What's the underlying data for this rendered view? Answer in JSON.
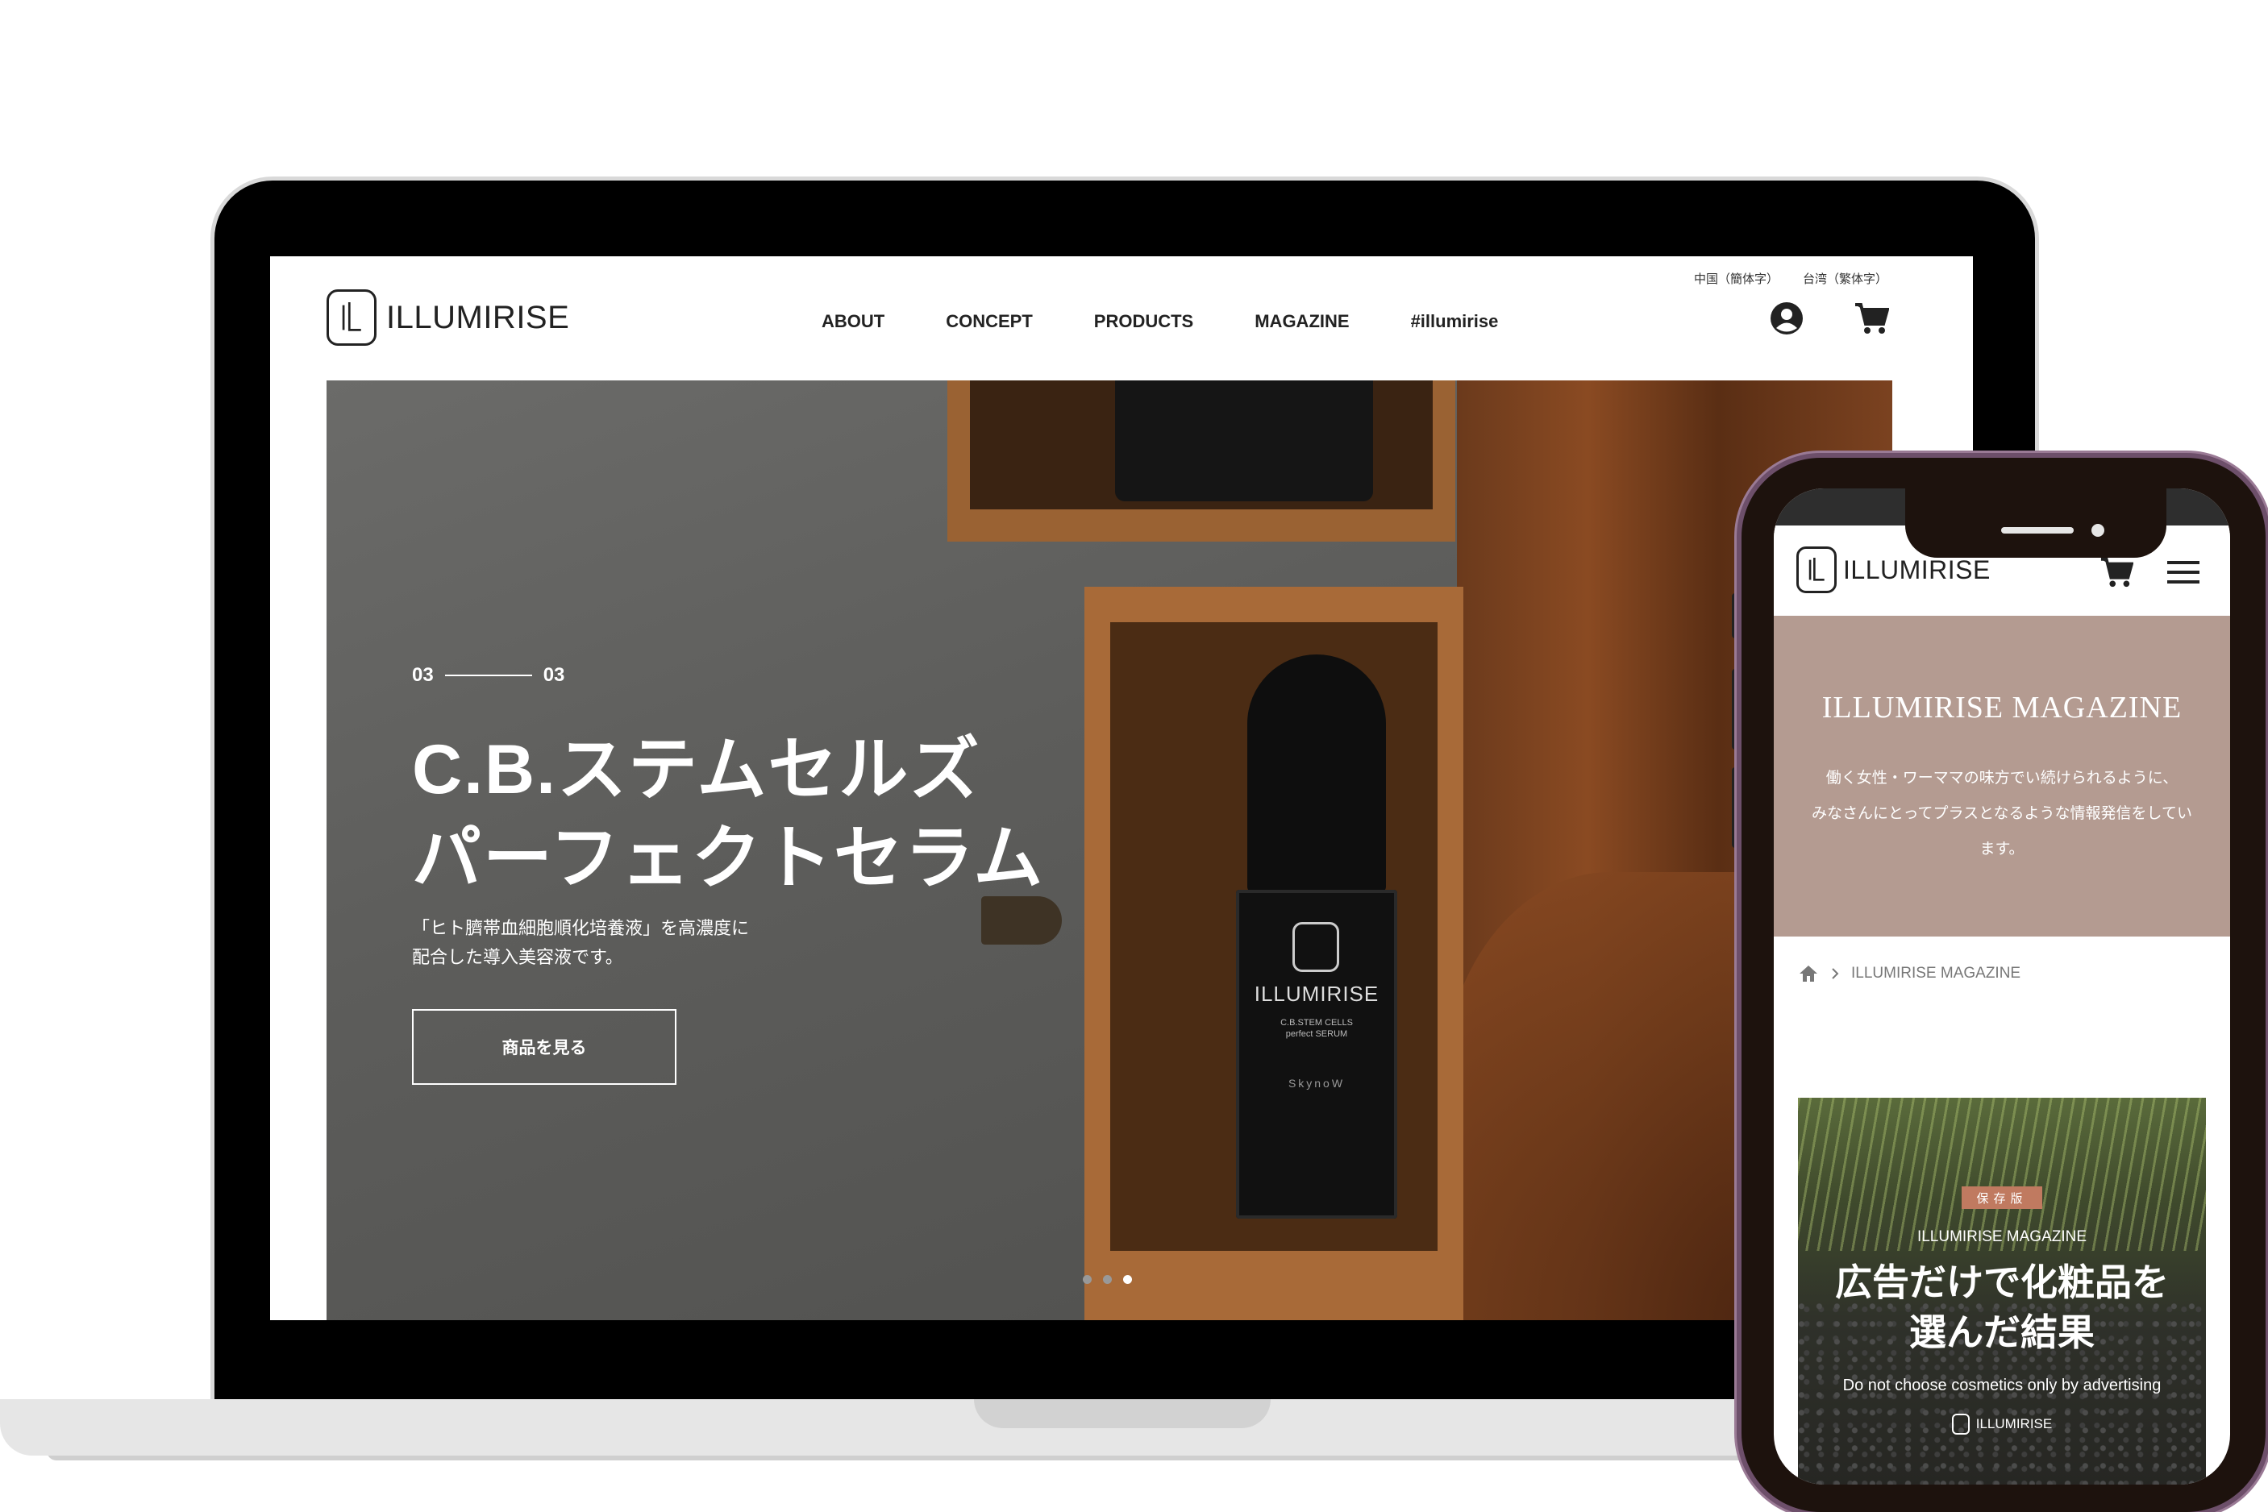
{
  "brand": {
    "name": "ILLUMIRISE"
  },
  "desktop": {
    "lang_links": [
      "中国（簡体字）",
      "台湾（繁体字）"
    ],
    "nav": [
      "ABOUT",
      "CONCEPT",
      "PRODUCTS",
      "MAGAZINE",
      "#illumirise"
    ],
    "icons": {
      "account": "account-circle-icon",
      "cart": "cart-icon"
    },
    "hero": {
      "counter_current": "03",
      "counter_total": "03",
      "title_line1": "C.B.ステムセルズ",
      "title_line2": "パーフェクトセラム",
      "desc_line1": "「ヒト臍帯血細胞順化培養液」を高濃度に",
      "desc_line2": "配合した導入美容液です。",
      "button": "商品を見る",
      "slides_total": 3,
      "slide_active_index": 2,
      "bottle_brand": "ILLUMIRISE",
      "bottle_sub_line1": "C.B.STEM CELLS",
      "bottle_sub_line2": "perfect SERUM",
      "bottle_maker": "SkynoW"
    }
  },
  "mobile": {
    "hero_title": "ILLUMIRISE MAGAZINE",
    "hero_text_line1": "働く女性・ワーママの味方でい続けられるように、",
    "hero_text_line2": "みなさんにとってプラスとなるような情報発信をしてい",
    "hero_text_line3": "ます。",
    "breadcrumb_current": "ILLUMIRISE MAGAZINE",
    "card": {
      "badge": "保存版",
      "label": "ILLUMIRISE MAGAZINE",
      "title_line1": "広告だけで化粧品を",
      "title_line2": "選んだ結果",
      "subtitle": "Do not choose cosmetics only by advertising",
      "logo_text": "ILLUMIRISE"
    }
  },
  "colors": {
    "mobile_hero_bg": "#b49b91",
    "phone_frame": "#6d4f6a",
    "badge": "#c07a60"
  }
}
